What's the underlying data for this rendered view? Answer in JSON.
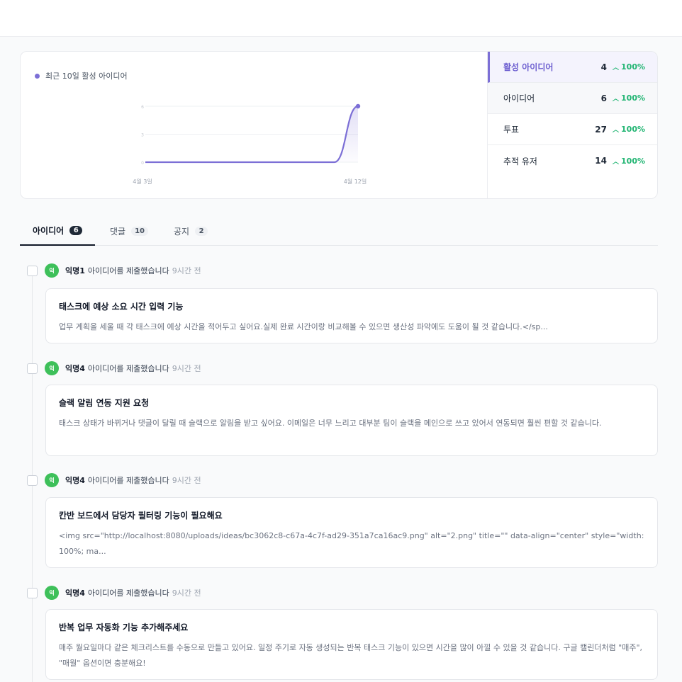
{
  "stats": {
    "legend_label": "최근 10일 활성 아이디어",
    "colors": {
      "accent": "#7c6fd6",
      "positive": "#22b573"
    },
    "metrics": [
      {
        "label": "활성 아이디어",
        "value": "4",
        "change": "100%"
      },
      {
        "label": "아이디어",
        "value": "6",
        "change": "100%"
      },
      {
        "label": "투표",
        "value": "27",
        "change": "100%"
      },
      {
        "label": "추적 유저",
        "value": "14",
        "change": "100%"
      }
    ]
  },
  "chart_data": {
    "type": "area",
    "title": "",
    "series": [
      {
        "name": "최근 10일 활성 아이디어",
        "values": [
          0,
          0,
          0,
          0,
          0,
          0,
          0,
          0,
          0,
          6
        ]
      }
    ],
    "x": [
      "4월 3일",
      "4월 4일",
      "4월 5일",
      "4월 6일",
      "4월 7일",
      "4월 8일",
      "4월 9일",
      "4월 10일",
      "4월 11일",
      "4월 12일"
    ],
    "x_tick_labels": [
      "4월 3일",
      "4월 12일"
    ],
    "y_tick_labels": [
      "0",
      "3",
      "6"
    ],
    "ylim": [
      0,
      6
    ],
    "grid": true
  },
  "tabs": [
    {
      "label": "아이디어",
      "count": "6"
    },
    {
      "label": "댓글",
      "count": "10"
    },
    {
      "label": "공지",
      "count": "2"
    }
  ],
  "feed": [
    {
      "avatar": "익",
      "author": "익명1",
      "action": "아이디어를 제출했습니다",
      "time": "9시간 전",
      "title": "태스크에 예상 소요 시간 입력 기능",
      "body": "업무 계획을 세울 때 각 태스크에 예상 시간을 적어두고 싶어요.실제 완료 시간이랑 비교해볼 수 있으면 생산성 파악에도 도움이 될 것 같습니다.</sp..."
    },
    {
      "avatar": "익",
      "author": "익명4",
      "action": "아이디어를 제출했습니다",
      "time": "9시간 전",
      "title": "슬랙 알림 연동 지원 요청",
      "body": "태스크 상태가 바뀌거나 댓글이 달릴 때 슬랙으로 알림을 받고 싶어요. 이메일은 너무 느리고 대부분 팀이 슬랙을 메인으로 쓰고 있어서 연동되면 훨씬 편할 것 같습니다."
    },
    {
      "avatar": "익",
      "author": "익명4",
      "action": "아이디어를 제출했습니다",
      "time": "9시간 전",
      "title": "칸반 보드에서 담당자 필터링 기능이 필요해요",
      "body": "<img src=\"http://localhost:8080/uploads/ideas/bc3062c8-c67a-4c7f-ad29-351a7ca16ac9.png\" alt=\"2.png\" title=\"\" data-align=\"center\" style=\"width: 100%; ma..."
    },
    {
      "avatar": "익",
      "author": "익명4",
      "action": "아이디어를 제출했습니다",
      "time": "9시간 전",
      "title": "반복 업무 자동화 기능 추가해주세요",
      "body": "매주 월요일마다 같은 체크리스트를 수동으로 만들고 있어요. 일정 주기로 자동 생성되는 반복 태스크 기능이 있으면 시간을 많이 아낄 수 있을 것 같습니다. 구글 캘린더처럼 \"매주\", \"매월\" 옵션이면 충분해요!"
    }
  ]
}
